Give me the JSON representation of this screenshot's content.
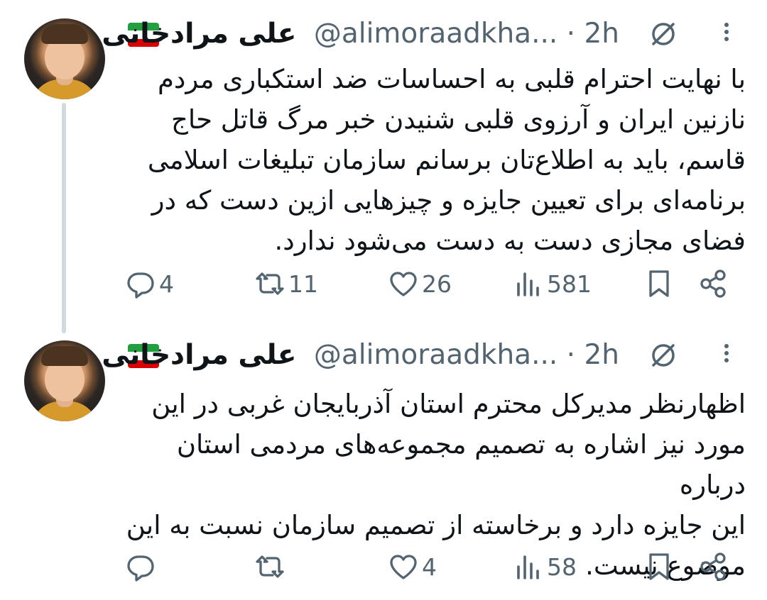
{
  "tweets": [
    {
      "name": "علی مرادخانی",
      "handle": "@alimoraadkha...",
      "time": "· 2h",
      "text_lines": [
        "با نهایت احترام قلبی به احساسات ضد استکباری مردم",
        "نازنین ایران و آرزوی قلبی شنیدن خبر مرگ قاتل حاج",
        "قاسم، باید به اطلاع‌تان برسانم سازمان تبلیغات اسلامی",
        "برنامه‌ای برای تعیین جایزه و چیزهایی ازین دست که در",
        "فضای مجازی دست به دست می‌شود ندارد."
      ],
      "replies": "4",
      "retweets": "11",
      "likes": "26",
      "views": "581"
    },
    {
      "name": "علی مرادخانی",
      "handle": "@alimoraadkha...",
      "time": "· 2h",
      "text_lines": [
        "اظهارنظر مدیرکل محترم استان آذربایجان غربی در این",
        "مورد نیز اشاره به تصمیم مجموعه‌های مردمی استان درباره",
        "این جایزه دارد و برخاسته از تصمیم سازمان نسبت به این",
        "موضوع نیست."
      ],
      "replies": "",
      "retweets": "",
      "likes": "4",
      "views": "58"
    }
  ],
  "icons": {
    "reply": "reply-icon",
    "retweet": "retweet-icon",
    "like": "heart-icon",
    "views": "views-icon",
    "bookmark": "bookmark-icon",
    "share": "share-icon",
    "flag": "iran-flag-icon",
    "mute": "ban-icon",
    "more": "more-icon"
  },
  "colors": {
    "text": "#0f1419",
    "muted": "#536471",
    "thread_line": "#cfd9de",
    "flag_green": "#239f40",
    "flag_white": "#ffffff",
    "flag_red": "#da0000"
  }
}
